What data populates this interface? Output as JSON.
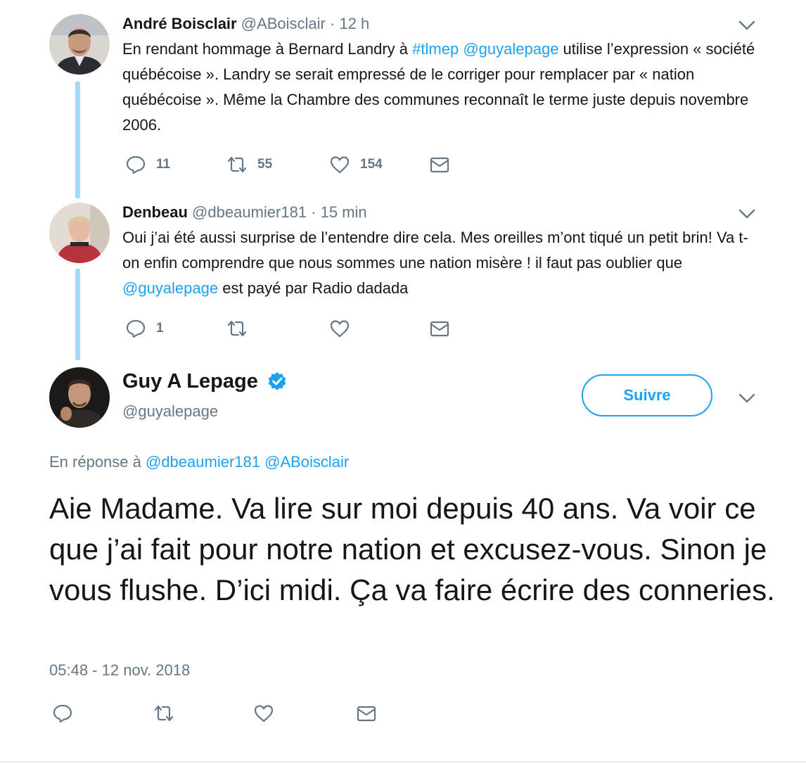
{
  "tweet1": {
    "name": "André Boisclair",
    "handle": "@ABoisclair",
    "dot": "·",
    "time": "12 h",
    "text_before": "En rendant hommage à Bernard Landry à ",
    "hashtag": "#tlmep",
    "space": " ",
    "mention": "@guyalepage",
    "text_after": "  utilise l’expression « société québécoise ». Landry se serait empressé de le corriger pour remplacer par « nation québécoise ». Même la Chambre des communes reconnaît le terme juste depuis novembre 2006.",
    "replies": "11",
    "retweets": "55",
    "likes": "154"
  },
  "tweet2": {
    "name": "Denbeau",
    "handle": "@dbeaumier181",
    "dot": "·",
    "time": "15 min",
    "text_before": "Oui j’ai été aussi surprise de l’entendre dire cela.  Mes oreilles m’ont tiqué un petit brin! Va t-on enfin comprendre que nous sommes une nation misère ! il faut pas oublier que ",
    "mention": "@guyalepage",
    "text_after": " est payé par Radio dadada",
    "replies": "1"
  },
  "main": {
    "name": "Guy A Lepage",
    "handle": "@guyalepage",
    "follow_label": "Suivre",
    "reply_prefix": "En réponse à ",
    "reply_mention_1": "@dbeaumier181",
    "reply_mention_2": "@ABoisclair",
    "space": " ",
    "text": "Aie Madame. Va lire sur moi depuis 40 ans. Va voir ce que j’ai fait pour notre nation et excusez-vous. Sinon je vous flushe. D’ici midi. Ça va faire écrire des conneries.",
    "timestamp": "05:48 - 12 nov. 2018"
  },
  "icons": {
    "reply": "reply-icon",
    "retweet": "retweet-icon",
    "like": "heart-icon",
    "dm": "envelope-icon",
    "verified": "verified-badge-icon",
    "more": "chevron-down-icon"
  },
  "colors": {
    "accent": "#1da1f2",
    "thread_line": "#a4d9f5",
    "muted": "#657786",
    "text": "#14171a"
  }
}
